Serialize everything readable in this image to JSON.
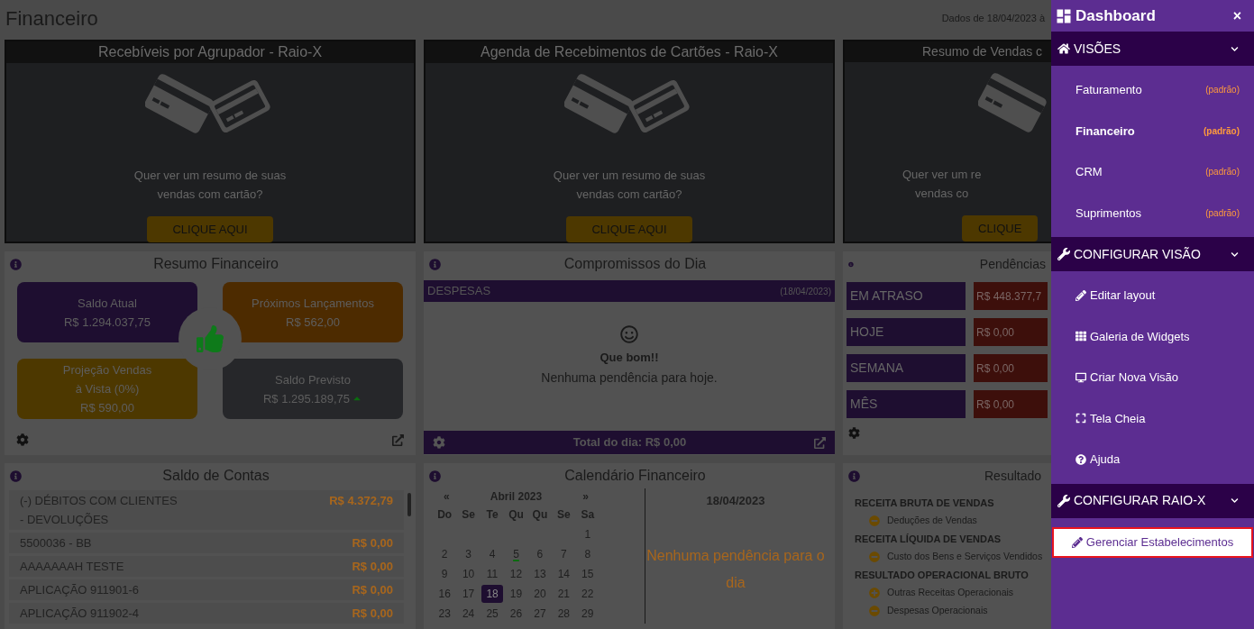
{
  "page": {
    "title": "Financeiro",
    "date_range": "Dados de 18/04/2023 à"
  },
  "promo_widgets": [
    {
      "title": "Recebíveis por Agrupador - Raio-X",
      "text_lines": [
        "Quer ver um resumo de suas",
        "vendas com cartão?"
      ],
      "button": "CLIQUE AQUI"
    },
    {
      "title": "Agenda de Recebimentos de Cartões - Raio-X",
      "text_lines": [
        "Quer ver um resumo de suas",
        "vendas com cartão?"
      ],
      "button": "CLIQUE AQUI"
    },
    {
      "title": "Resumo de Vendas c",
      "text_lines": [
        "Quer ver um re",
        "vendas co"
      ],
      "button": "CLIQUE"
    }
  ],
  "resumo_financeiro": {
    "title": "Resumo Financeiro",
    "tiles": [
      {
        "label_lines": [
          "Saldo Atual"
        ],
        "value": "R$ 1.294.037,75",
        "color": "#1e0e30",
        "trend_up": false
      },
      {
        "label_lines": [
          "Próximos Lançamentos"
        ],
        "value": "R$ 562,00",
        "color": "#4d2b00",
        "trend_up": false
      },
      {
        "label_lines": [
          "Projeção Vendas",
          "à Vista (0%)"
        ],
        "value": "R$ 590,00",
        "color": "#4d3800",
        "trend_up": false
      },
      {
        "label_lines": [
          "Saldo Previsto"
        ],
        "value": "R$ 1.295.189,75",
        "color": "#26272a",
        "trend_up": true
      }
    ]
  },
  "compromissos": {
    "title": "Compromissos do Dia",
    "category": "DESPESAS",
    "date": "(18/04/2023)",
    "heading": "Que bom!!",
    "message": "Nenhuma pendência para hoje.",
    "total": "Total do dia: R$ 0,00"
  },
  "pendencias": {
    "title": "Pendências",
    "rows": [
      {
        "label": "EM ATRASO",
        "value": "R$ 448.377,7"
      },
      {
        "label": "HOJE",
        "value": "R$ 0,00"
      },
      {
        "label": "SEMANA",
        "value": "R$ 0,00"
      },
      {
        "label": "MÊS",
        "value": "R$ 0,00"
      }
    ]
  },
  "saldo_contas": {
    "title": "Saldo de Contas",
    "rows": [
      {
        "name": "(-) DÉBITOS COM CLIENTES - DEVOLUÇÕES",
        "value": "R$ 4.372,79"
      },
      {
        "name": "5500036 - BB",
        "value": "R$ 0,00"
      },
      {
        "name": "AAAAAAAH TESTE",
        "value": "R$ 0,00"
      },
      {
        "name": "APLICAÇÃO 911901-6",
        "value": "R$ 0,00"
      },
      {
        "name": "APLICAÇÃO 911902-4",
        "value": "R$ 0,00"
      }
    ]
  },
  "calendario": {
    "title": "Calendário Financeiro",
    "prev": "«",
    "month": "Abril 2023",
    "next": "»",
    "weekdays": [
      "Do",
      "Se",
      "Te",
      "Qu",
      "Qu",
      "Se",
      "Sa"
    ],
    "weeks": [
      [
        {
          "day": "1",
          "selected": false,
          "has_event": false
        }
      ],
      [
        {
          "day": "2",
          "selected": false,
          "has_event": false
        },
        {
          "day": "3",
          "selected": false,
          "has_event": false
        },
        {
          "day": "4",
          "selected": false,
          "has_event": false
        },
        {
          "day": "5",
          "selected": false,
          "has_event": true
        },
        {
          "day": "6",
          "selected": false,
          "has_event": false
        },
        {
          "day": "7",
          "selected": false,
          "has_event": false
        },
        {
          "day": "8",
          "selected": false,
          "has_event": false
        }
      ],
      [
        {
          "day": "9",
          "selected": false,
          "has_event": false
        },
        {
          "day": "10",
          "selected": false,
          "has_event": false
        },
        {
          "day": "11",
          "selected": false,
          "has_event": false
        },
        {
          "day": "12",
          "selected": false,
          "has_event": false
        },
        {
          "day": "13",
          "selected": false,
          "has_event": false
        },
        {
          "day": "14",
          "selected": false,
          "has_event": false
        },
        {
          "day": "15",
          "selected": false,
          "has_event": false
        }
      ],
      [
        {
          "day": "16",
          "selected": false,
          "has_event": false
        },
        {
          "day": "17",
          "selected": false,
          "has_event": false
        },
        {
          "day": "18",
          "selected": true,
          "has_event": false
        },
        {
          "day": "19",
          "selected": false,
          "has_event": false
        },
        {
          "day": "20",
          "selected": false,
          "has_event": false
        },
        {
          "day": "21",
          "selected": false,
          "has_event": false
        },
        {
          "day": "22",
          "selected": false,
          "has_event": false
        }
      ],
      [
        {
          "day": "23",
          "selected": false,
          "has_event": false
        },
        {
          "day": "24",
          "selected": false,
          "has_event": false
        },
        {
          "day": "25",
          "selected": false,
          "has_event": false
        },
        {
          "day": "26",
          "selected": false,
          "has_event": false
        },
        {
          "day": "27",
          "selected": false,
          "has_event": false
        },
        {
          "day": "28",
          "selected": false,
          "has_event": false
        },
        {
          "day": "29",
          "selected": false,
          "has_event": false
        }
      ]
    ],
    "day_title": "18/04/2023",
    "day_message": "Nenhuma pendência para o dia"
  },
  "resultado": {
    "title": "Resultado",
    "lines": [
      {
        "kind": "group",
        "text": "RECEITA BRUTA DE VENDAS"
      },
      {
        "kind": "minus",
        "text": "Deduções de Vendas"
      },
      {
        "kind": "group",
        "text": "RECEITA LÍQUIDA DE VENDAS"
      },
      {
        "kind": "minus",
        "text": "Custo dos Bens e Serviços Vendidos"
      },
      {
        "kind": "group",
        "text": "RESULTADO OPERACIONAL BRUTO"
      },
      {
        "kind": "plus",
        "text": "Outras Receitas Operacionais"
      },
      {
        "kind": "minus",
        "text": "Despesas Operacionais"
      }
    ]
  },
  "sidebar": {
    "title": "Dashboard",
    "close": "×",
    "sections": [
      {
        "title": "VISÕES",
        "expanded": true,
        "items": [
          {
            "label": "Faturamento",
            "badge": "(padrão)",
            "selected": false
          },
          {
            "label": "Financeiro",
            "badge": "(padrão)",
            "selected": true
          },
          {
            "label": "CRM",
            "badge": "(padrão)",
            "selected": false
          },
          {
            "label": "Suprimentos",
            "badge": "(padrão)",
            "selected": false
          }
        ]
      },
      {
        "title": "CONFIGURAR VISÃO",
        "expanded": true,
        "items": [
          {
            "label": "Editar layout",
            "selected": false
          },
          {
            "label": "Galeria de Widgets",
            "selected": false
          },
          {
            "label": "Criar Nova Visão",
            "selected": false
          },
          {
            "label": "Tela Cheia",
            "selected": false
          },
          {
            "label": "Ajuda",
            "selected": false
          }
        ]
      },
      {
        "title": "CONFIGURAR RAIO-X",
        "expanded": true,
        "items": [
          {
            "label": "Gerenciar Estabelecimentos",
            "selected": true
          }
        ]
      }
    ]
  }
}
